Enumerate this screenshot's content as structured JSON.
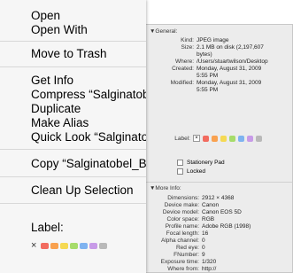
{
  "menu": {
    "items": [
      "Open",
      "Open With",
      "Move to Trash",
      "Get Info",
      "Compress “Salginatobe",
      "Duplicate",
      "Make Alias",
      "Quick Look “Salginatob",
      "Copy “Salginatobel_Bric",
      "Clean Up Selection",
      "Label:"
    ],
    "label_x": "×",
    "label_colors": [
      "#f26b5f",
      "#f9a14f",
      "#f5d953",
      "#a6dc6a",
      "#7fb3f0",
      "#c89be8",
      "#b9b9b9"
    ]
  },
  "info": {
    "general_header": "▼General:",
    "general": [
      {
        "key": "Kind:",
        "value": "JPEG image"
      },
      {
        "key": "Size:",
        "value": "2.1 MB on disk (2,197,607"
      },
      {
        "key": "",
        "value": "bytes)"
      },
      {
        "key": "Where:",
        "value": "/Users/stuartwilson/Desktop"
      },
      {
        "key": "Created:",
        "value": "Monday, August 31, 2009"
      },
      {
        "key": "",
        "value": "5:55 PM"
      },
      {
        "key": "Modified:",
        "value": "Monday, August 31, 2009"
      },
      {
        "key": "",
        "value": "5:55 PM"
      }
    ],
    "label_key": "Label:",
    "label_x": "×",
    "label_colors": [
      "#f26b5f",
      "#f9a14f",
      "#f5d953",
      "#a6dc6a",
      "#7fb3f0",
      "#c89be8",
      "#b9b9b9"
    ],
    "stationery_label": "Stationery Pad",
    "locked_label": "Locked",
    "more_header": "▼More Info:",
    "more": [
      {
        "key": "Dimensions:",
        "value": "2912 × 4368"
      },
      {
        "key": "Device make:",
        "value": "Canon"
      },
      {
        "key": "Device model:",
        "value": "Canon EOS 5D"
      },
      {
        "key": "Color space:",
        "value": "RGB"
      },
      {
        "key": "Profile name:",
        "value": "Adobe RGB (1998)"
      },
      {
        "key": "Focal length:",
        "value": "16"
      },
      {
        "key": "Alpha channel:",
        "value": "0"
      },
      {
        "key": "Red eye:",
        "value": "0"
      },
      {
        "key": "FNumber:",
        "value": "9"
      },
      {
        "key": "Exposure time:",
        "value": "1/320"
      },
      {
        "key": "Where from:",
        "value": "http://"
      }
    ]
  }
}
